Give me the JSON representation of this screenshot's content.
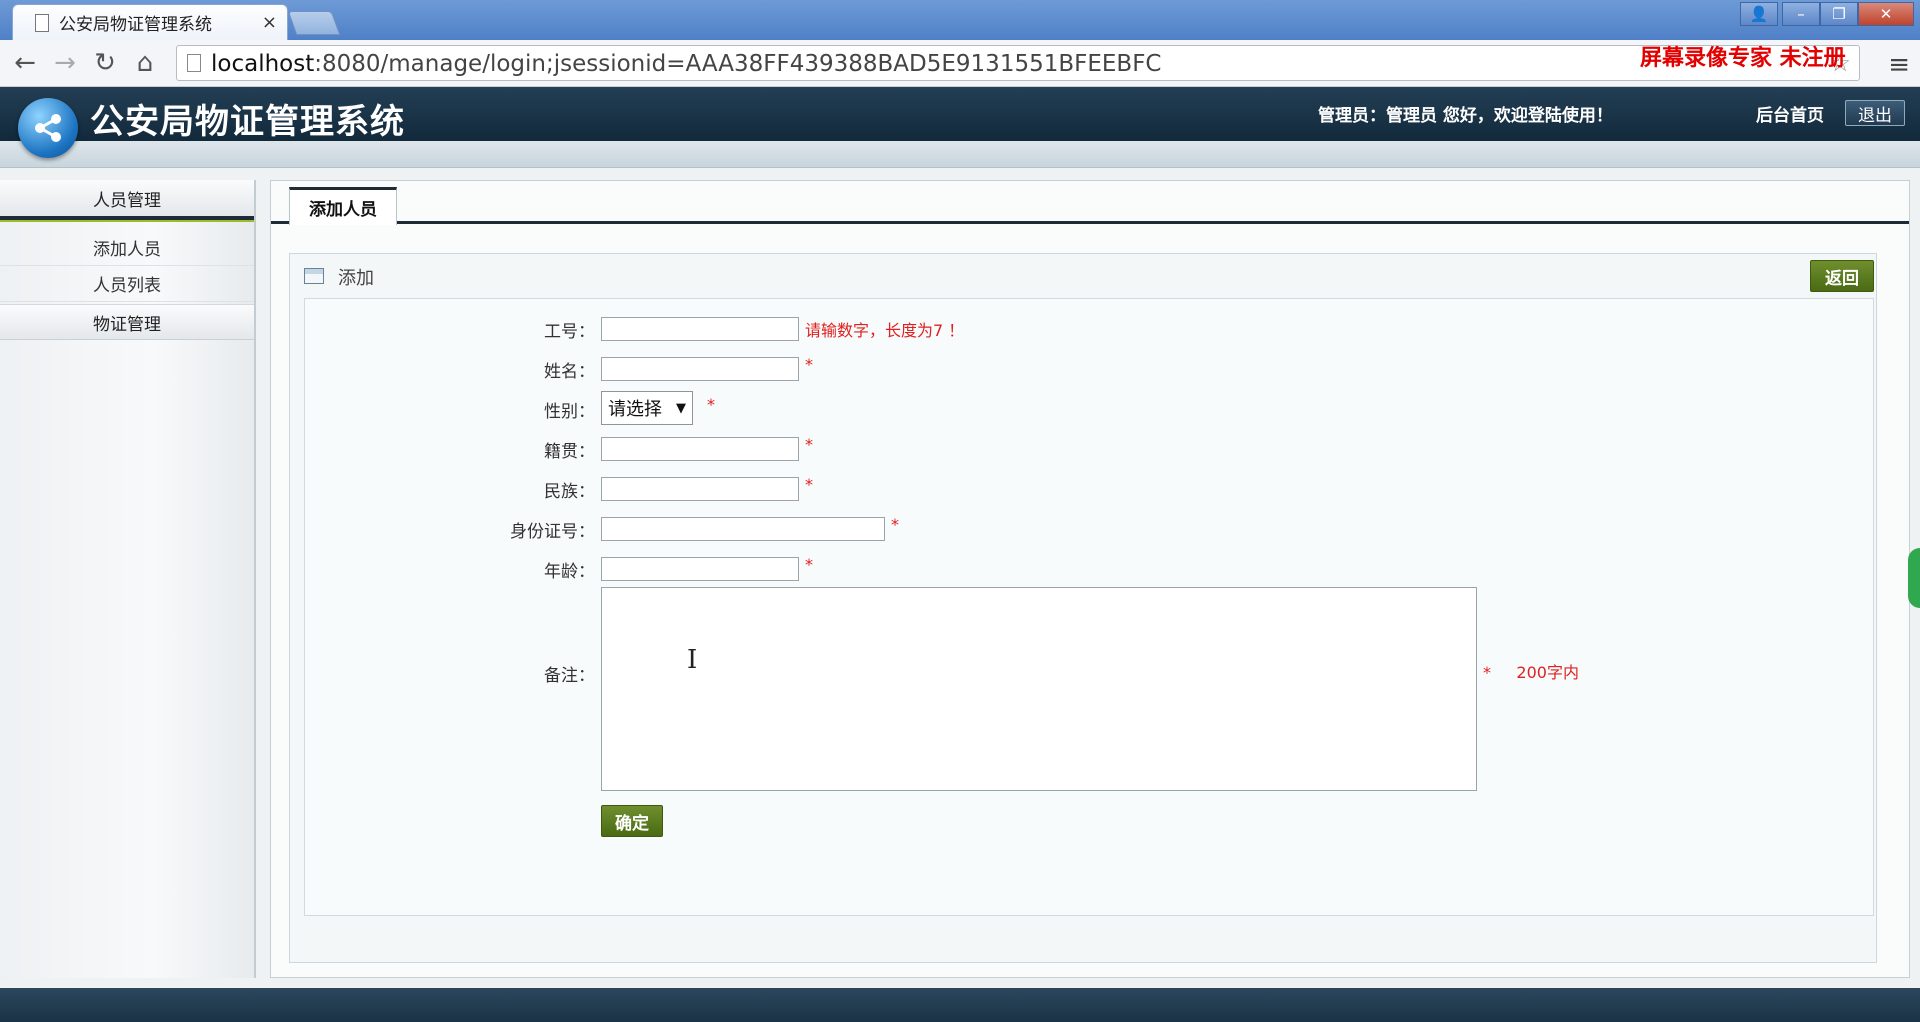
{
  "browser": {
    "tab_title": "公安局物证管理系统",
    "tab_close": "×",
    "url_host": "localhost",
    "url_rest": ":8080/manage/login;jsessionid=AAA38FF439388BAD5E9131551BFEEBFC",
    "nav": {
      "back": "←",
      "forward": "→",
      "reload": "↻",
      "home": "⌂"
    },
    "bookmark_star": "☆",
    "menu": "≡",
    "window_controls": {
      "user": "👤",
      "minimize": "–",
      "restore": "❐",
      "close": "✕"
    }
  },
  "watermark": "屏幕录像专家  未注册",
  "header": {
    "title": "公安局物证管理系统",
    "welcome": "管理员：管理员 您好，欢迎登陆使用！",
    "home_link": "后台首页",
    "logout": "退出"
  },
  "sidebar": {
    "section_personnel": "人员管理",
    "items": [
      {
        "label": "添加人员"
      },
      {
        "label": "人员列表"
      }
    ],
    "section_evidence": "物证管理"
  },
  "main": {
    "tab_label": "添加人员",
    "panel_title": "添加",
    "back_button": "返回",
    "form": {
      "fields": {
        "job_no": {
          "label": "工号：",
          "hint": "请输数字，长度为7 ！"
        },
        "name": {
          "label": "姓名：",
          "hint": "*"
        },
        "gender": {
          "label": "性别：",
          "selected": "请选择",
          "caret": "▼",
          "hint": "*"
        },
        "native_place": {
          "label": "籍贯：",
          "hint": "*"
        },
        "ethnicity": {
          "label": "民族：",
          "hint": "*"
        },
        "id_number": {
          "label": "身份证号：",
          "hint": "*"
        },
        "age": {
          "label": "年龄：",
          "hint": "*"
        },
        "remark": {
          "label": "备注：",
          "hint": "*     200字内"
        }
      },
      "submit": "确定"
    }
  },
  "colors": {
    "header_bg": "#1a3346",
    "accent_green": "#4a6a14",
    "required_red": "#e02020",
    "sidebar_active_bar": "#9cbc2c"
  }
}
